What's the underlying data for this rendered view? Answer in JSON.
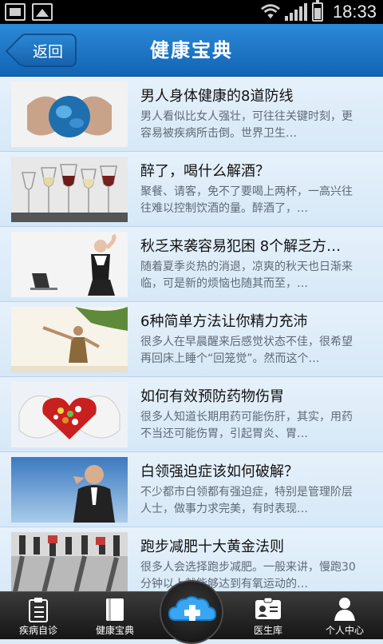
{
  "status_bar": {
    "time": "18:33"
  },
  "header": {
    "back_label": "返回",
    "title": "健康宝典"
  },
  "articles": [
    {
      "title": "男人身体健康的8道防线",
      "summary": "男人看似比女人强壮，可往往关键时刻，更容易被疾病所击倒。世界卫生…"
    },
    {
      "title": "醉了，喝什么解酒？",
      "summary": "聚餐、请客，免不了要喝上两杯，一高兴往往难以控制饮酒的量。醉酒了，…"
    },
    {
      "title": "秋乏来袭容易犯困 8个解乏方…",
      "summary": "随着夏季炎热的消退，凉爽的秋天也日渐来临，可是新的烦恼也随其而至，…"
    },
    {
      "title": "6种简单方法让你精力充沛",
      "summary": "很多人在早晨醒来后感觉状态不佳，很希望再回床上睡个“回笼觉”。然而这个…"
    },
    {
      "title": "如何有效预防药物伤胃",
      "summary": "很多人知道长期用药可能伤肝，其实，用药不当还可能伤胃，引起胃炎、胃…"
    },
    {
      "title": "白领强迫症该如何破解？",
      "summary": "不少都市白领都有强迫症，特别是管理阶层人士，做事力求完美，有时表现…"
    },
    {
      "title": "跑步减肥十大黄金法则",
      "summary": "很多人会选择跑步减肥。一般来讲，慢跑30分钟以上就能够达到有氧运动的…"
    }
  ],
  "tabs": [
    {
      "label": "疾病自诊",
      "icon": "clipboard-icon"
    },
    {
      "label": "健康宝典",
      "icon": "book-icon"
    },
    {
      "label": "",
      "icon": "cloud-plus-icon"
    },
    {
      "label": "医生库",
      "icon": "doctor-id-icon"
    },
    {
      "label": "个人中心",
      "icon": "person-icon"
    }
  ],
  "colors": {
    "header": "#1a74c6",
    "list_bg": "#dceaf6",
    "tab_bg": "#222222",
    "accent": "#3aa0e8"
  }
}
